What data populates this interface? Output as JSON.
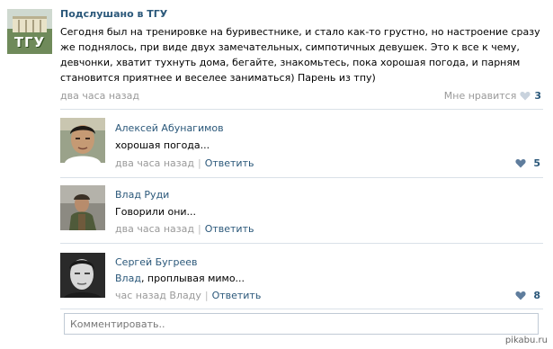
{
  "post": {
    "group_name": "Подслушано в ТГУ",
    "group_logo_text": "ТГУ",
    "text": "Сегодня был на тренировке на буривестнике, и стало как-то грустно, но настроение сразу же поднялось, при виде двух замечательных, симпотичных девушек. Это к все к чему, девчонки, хватит тухнуть дома, бегайте, знакомьтесь, пока хорошая погода, и парням становится приятнее и веселее заниматься) Парень из тпу)",
    "time": "два часа назад",
    "like_label": "Мне нравится",
    "like_count": "3"
  },
  "comments": [
    {
      "author": "Алексей Абунагимов",
      "text": "хорошая погода...",
      "time": "два часа назад",
      "separator": "|",
      "reply_label": "Ответить",
      "like_count": "5"
    },
    {
      "author": "Влад Руди",
      "text": "Говорили они...",
      "time": "два часа назад",
      "separator": "|",
      "reply_label": "Ответить",
      "like_count": ""
    },
    {
      "author": "Сергей Бугреев",
      "reply_to": "Влад",
      "text": ", проплывая мимо...",
      "time": "час назад Владу",
      "separator": "|",
      "reply_label": "Ответить",
      "like_count": "8"
    }
  ],
  "comment_box": {
    "placeholder": "Комментировать.."
  },
  "watermark": "pikabu.ru",
  "colors": {
    "link": "#2b587a",
    "muted": "#999999",
    "divider": "#dae1e8",
    "heart": "#5f7d9d"
  }
}
